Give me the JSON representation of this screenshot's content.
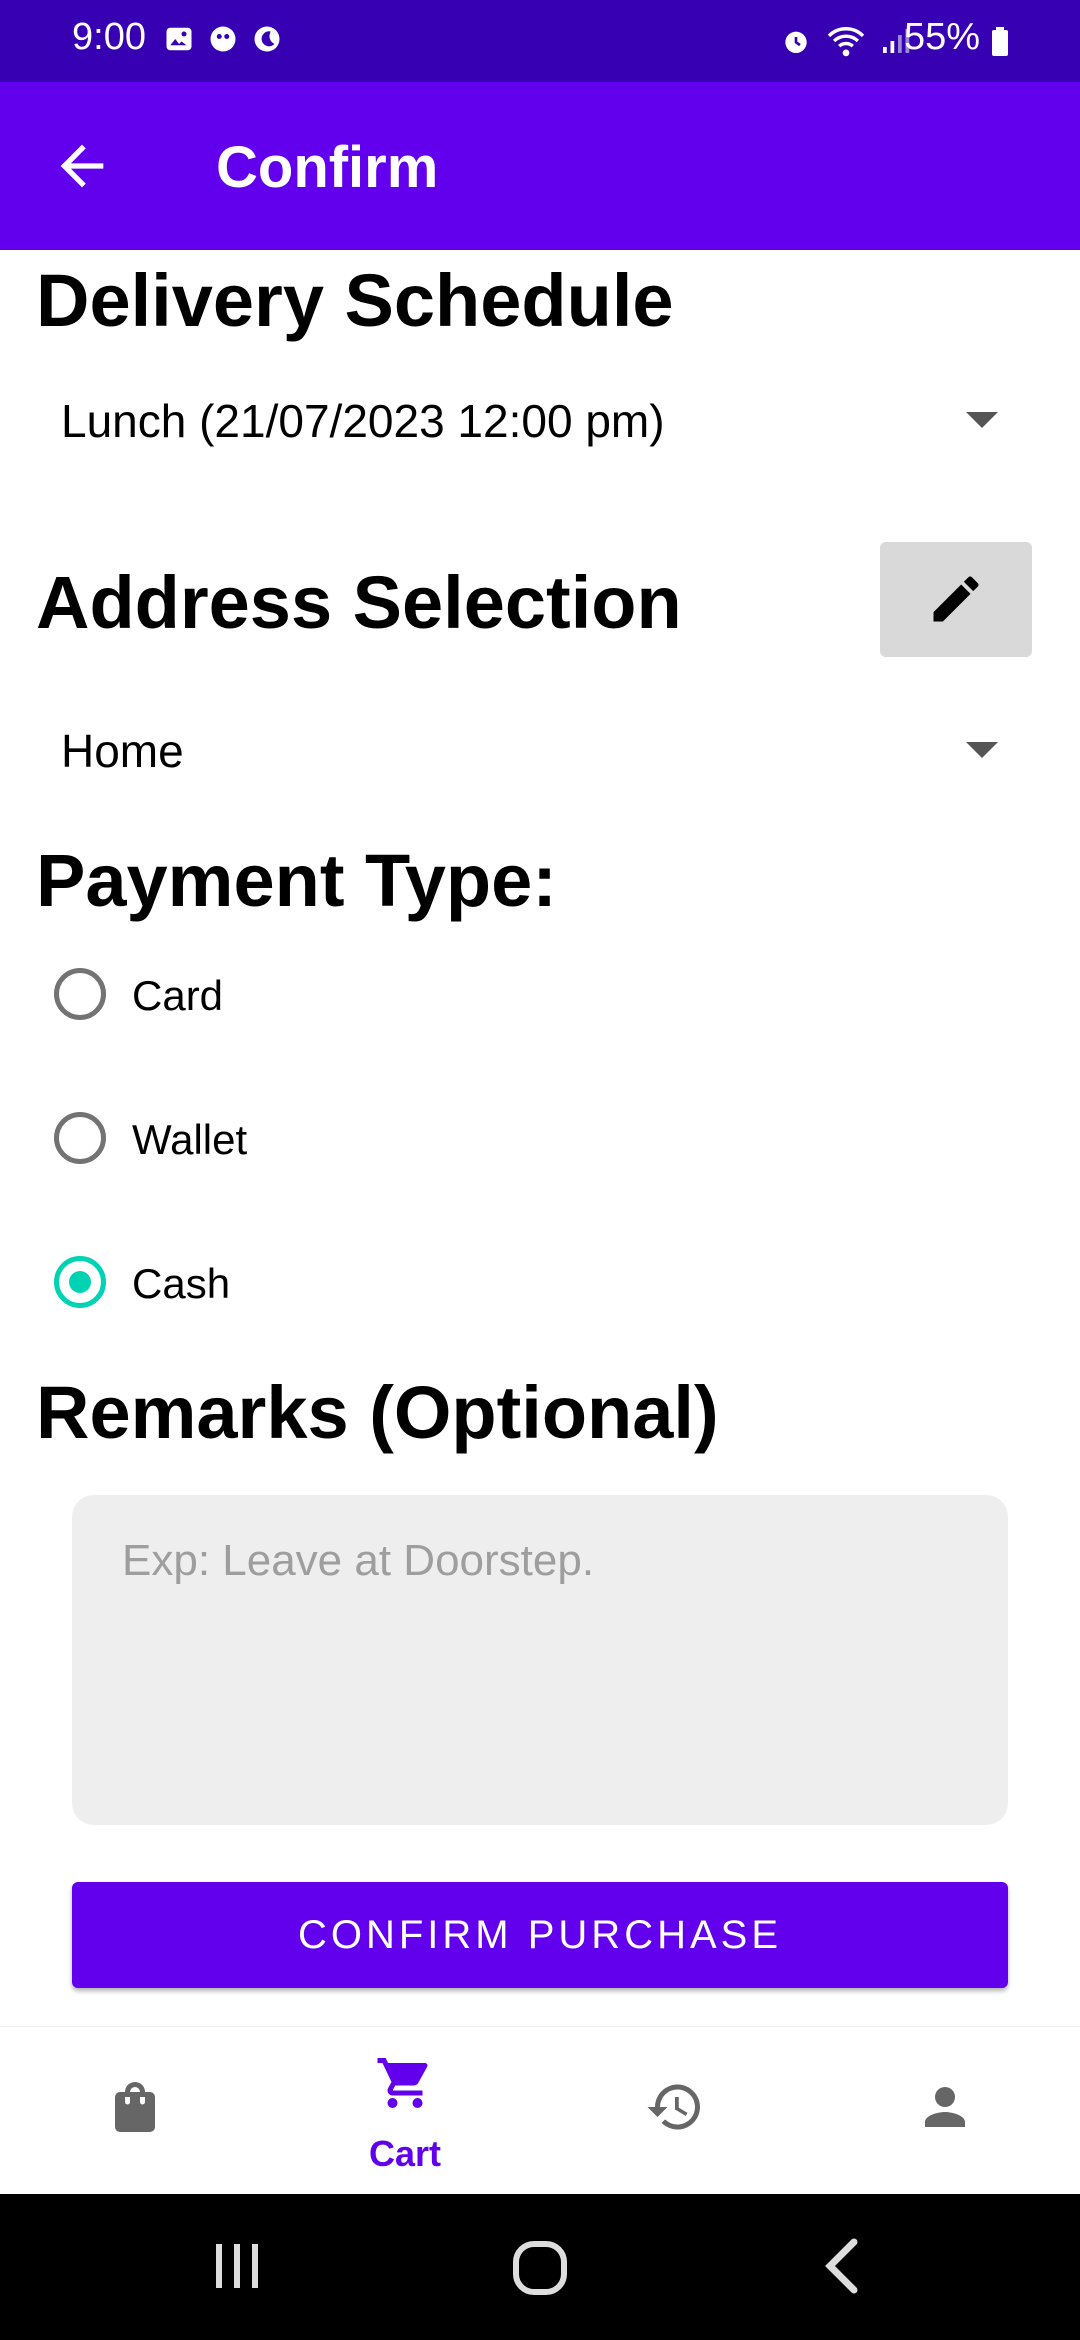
{
  "status_bar": {
    "time": "9:00",
    "battery": "55%",
    "left_icons": [
      "gallery-icon",
      "app-icon",
      "night-mode-icon"
    ],
    "right_icons": [
      "alarm-icon",
      "wifi-icon",
      "signal-icon",
      "battery-icon"
    ]
  },
  "app_bar": {
    "title": "Confirm",
    "back_icon": "arrow-back-icon"
  },
  "delivery": {
    "title": "Delivery Schedule",
    "selected": "Lunch (21/07/2023 12:00 pm)"
  },
  "address": {
    "title": "Address Selection",
    "selected": "Home",
    "edit_icon": "edit-pencil-icon"
  },
  "payment": {
    "title": "Payment Type:",
    "options": [
      {
        "label": "Card",
        "checked": false
      },
      {
        "label": "Wallet",
        "checked": false
      },
      {
        "label": "Cash",
        "checked": true
      }
    ]
  },
  "remarks": {
    "title": "Remarks (Optional)",
    "placeholder": "Exp: Leave at Doorstep.",
    "value": ""
  },
  "confirm_button": "CONFIRM PURCHASE",
  "bottom_nav": {
    "items": [
      {
        "icon": "shopping-bag-icon",
        "label": ""
      },
      {
        "icon": "cart-icon",
        "label": "Cart",
        "active": true
      },
      {
        "icon": "history-icon",
        "label": ""
      },
      {
        "icon": "person-icon",
        "label": ""
      }
    ]
  },
  "colors": {
    "primary": "#6200ee",
    "primary_dark": "#3700b3",
    "accent": "#00d2b4"
  }
}
